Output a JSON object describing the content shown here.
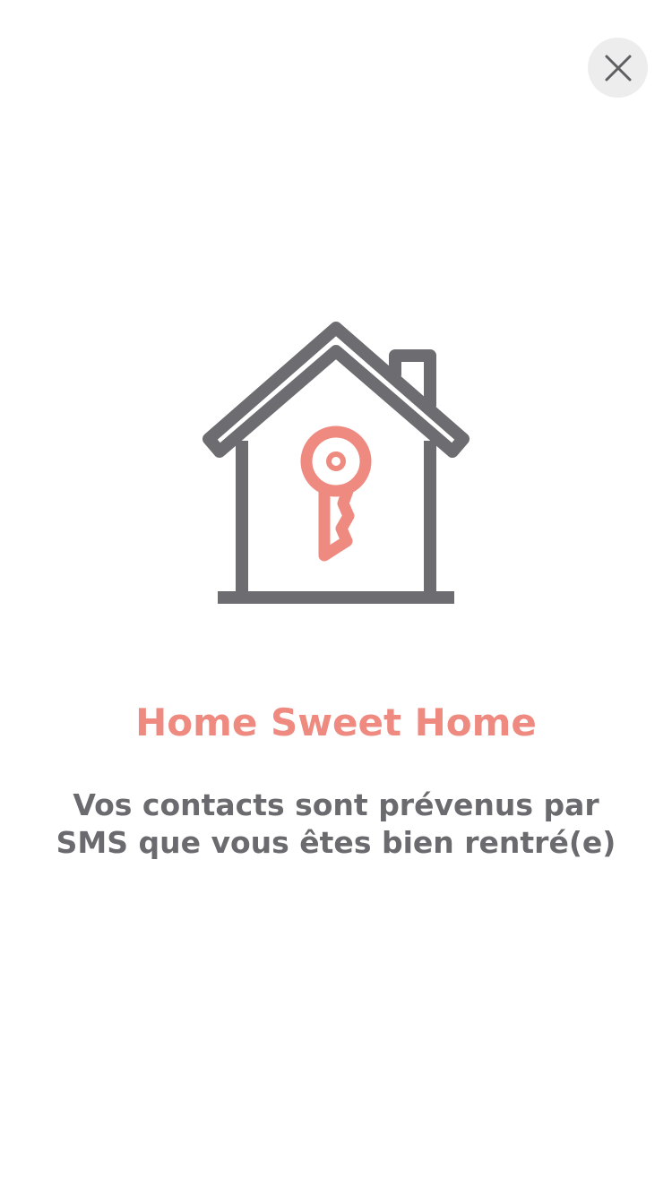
{
  "header": {
    "close_icon": "close-icon"
  },
  "illustration": {
    "house_icon": "house-icon",
    "key_icon": "key-icon",
    "colors": {
      "house": "#6d6d71",
      "key": "#ef8a80"
    }
  },
  "content": {
    "title": "Home Sweet Home",
    "message_line1": "Vos contacts sont prévenus par",
    "message_line2": "SMS que vous êtes bien rentré(e)"
  },
  "colors": {
    "accent": "#ee8a80",
    "text": "#6b6b6f",
    "close_bg": "#ededed"
  }
}
